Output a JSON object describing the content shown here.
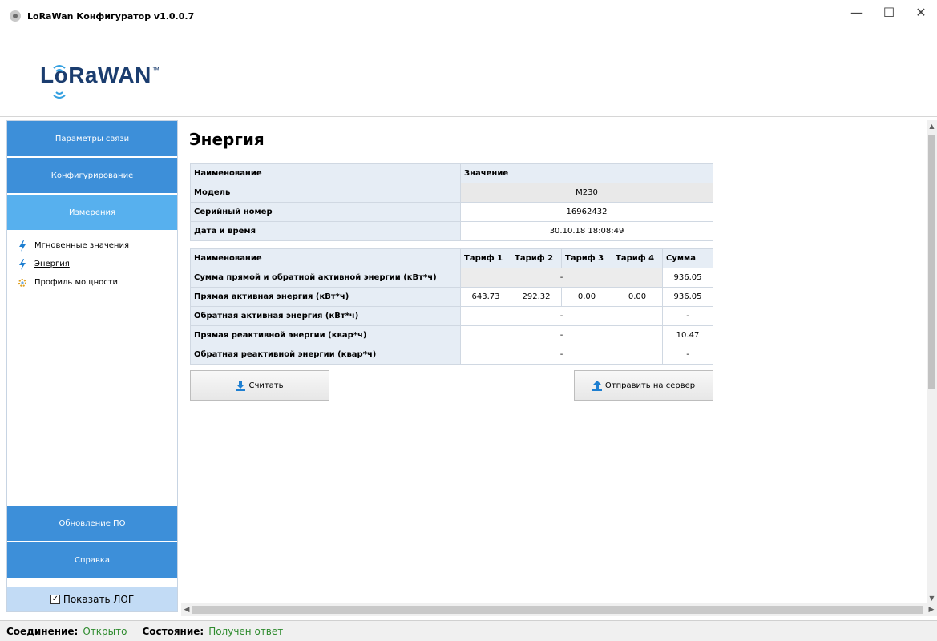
{
  "window": {
    "title": "LoRaWan Конфигуратор v1.0.0.7",
    "minimize": "—",
    "maximize": "☐",
    "close": "✕"
  },
  "logo": {
    "text": "LoRaWAN",
    "tm": "™"
  },
  "sidebar": {
    "nav_top": [
      {
        "label": "Параметры связи"
      },
      {
        "label": "Конфигурирование"
      },
      {
        "label": "Измерения"
      }
    ],
    "items": [
      {
        "label": "Мгновенные значения",
        "icon": "lightning-icon"
      },
      {
        "label": "Энергия",
        "icon": "lightning-icon"
      },
      {
        "label": "Профиль мощности",
        "icon": "gear-icon"
      }
    ],
    "nav_bottom": [
      {
        "label": "Обновление ПО"
      },
      {
        "label": "Справка"
      }
    ],
    "show_log": {
      "label": "Показать ЛОГ",
      "checked": true
    }
  },
  "page": {
    "title": "Энергия"
  },
  "info_table": {
    "headers": [
      "Наименование",
      "Значение"
    ],
    "rows": [
      {
        "name": "Модель",
        "value": "M230"
      },
      {
        "name": "Серийный номер",
        "value": "16962432"
      },
      {
        "name": "Дата и время",
        "value": "30.10.18 18:08:49"
      }
    ]
  },
  "energy_table": {
    "headers": [
      "Наименование",
      "Тариф 1",
      "Тариф 2",
      "Тариф 3",
      "Тариф 4",
      "Сумма"
    ],
    "rows": [
      {
        "name": "Сумма прямой и обратной активной энергии (кВт*ч)",
        "merged": "-",
        "sum": "936.05"
      },
      {
        "name": "Прямая активная энергия (кВт*ч)",
        "t1": "643.73",
        "t2": "292.32",
        "t3": "0.00",
        "t4": "0.00",
        "sum": "936.05"
      },
      {
        "name": "Обратная активная энергия (кВт*ч)",
        "merged": "-",
        "sum": "-"
      },
      {
        "name": "Прямая реактивной энергии (квар*ч)",
        "merged": "-",
        "sum": "10.47"
      },
      {
        "name": "Обратная реактивной энергии (квар*ч)",
        "merged": "-",
        "sum": "-"
      }
    ]
  },
  "buttons": {
    "read": "Считать",
    "send": "Отправить на сервер"
  },
  "status": {
    "connection_label": "Соединение:",
    "connection_value": "Открыто",
    "state_label": "Состояние:",
    "state_value": "Получен ответ"
  },
  "colors": {
    "nav": "#3d8fd9",
    "nav_active": "#57b0ee",
    "ok_text": "#2e8b2e",
    "icon_blue": "#1e7fd1"
  }
}
